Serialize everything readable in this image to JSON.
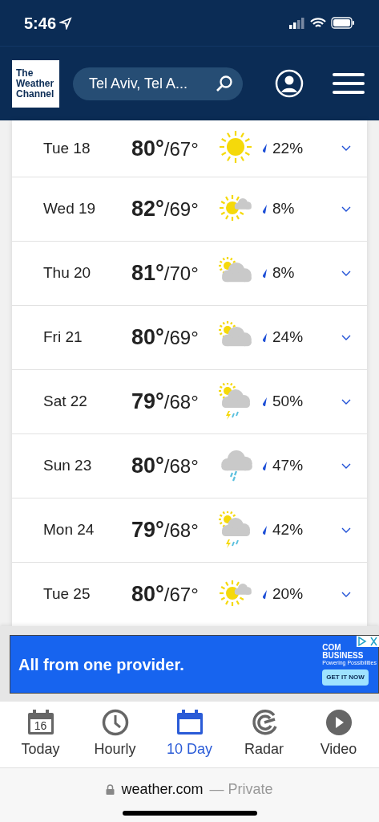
{
  "status_bar": {
    "time": "5:46"
  },
  "header": {
    "logo": [
      "The",
      "Weather",
      "Channel"
    ],
    "search": {
      "value": "Tel Aviv, Tel A..."
    }
  },
  "days": [
    {
      "day": "Tue 18",
      "high": "80°",
      "low": "/67°",
      "kind": "sunny",
      "precip": "22%"
    },
    {
      "day": "Wed 19",
      "high": "82°",
      "low": "/69°",
      "kind": "mostly-sunny",
      "precip": "8%"
    },
    {
      "day": "Thu 20",
      "high": "81°",
      "low": "/70°",
      "kind": "partly-cloudy",
      "precip": "8%"
    },
    {
      "day": "Fri 21",
      "high": "80°",
      "low": "/69°",
      "kind": "partly-cloudy",
      "precip": "24%"
    },
    {
      "day": "Sat 22",
      "high": "79°",
      "low": "/68°",
      "kind": "thunder",
      "precip": "50%"
    },
    {
      "day": "Sun 23",
      "high": "80°",
      "low": "/68°",
      "kind": "showers",
      "precip": "47%"
    },
    {
      "day": "Mon 24",
      "high": "79°",
      "low": "/68°",
      "kind": "thunder",
      "precip": "42%"
    },
    {
      "day": "Tue 25",
      "high": "80°",
      "low": "/67°",
      "kind": "mostly-sunny",
      "precip": "20%"
    }
  ],
  "ad": {
    "headline": "All from one provider.",
    "brand": [
      "COM",
      "BUSINESS"
    ],
    "tagline": "Powering Possibilities",
    "button": "GET IT NOW"
  },
  "nav": [
    {
      "label": "Today",
      "kind": "calendar-date",
      "badge": "16",
      "selected": false
    },
    {
      "label": "Hourly",
      "kind": "clock",
      "selected": false
    },
    {
      "label": "10 Day",
      "kind": "calendar",
      "selected": true
    },
    {
      "label": "Radar",
      "kind": "radar",
      "selected": false
    },
    {
      "label": "Video",
      "kind": "play",
      "selected": false
    }
  ],
  "browser": {
    "domain": "weather.com",
    "mode": "— Private"
  }
}
